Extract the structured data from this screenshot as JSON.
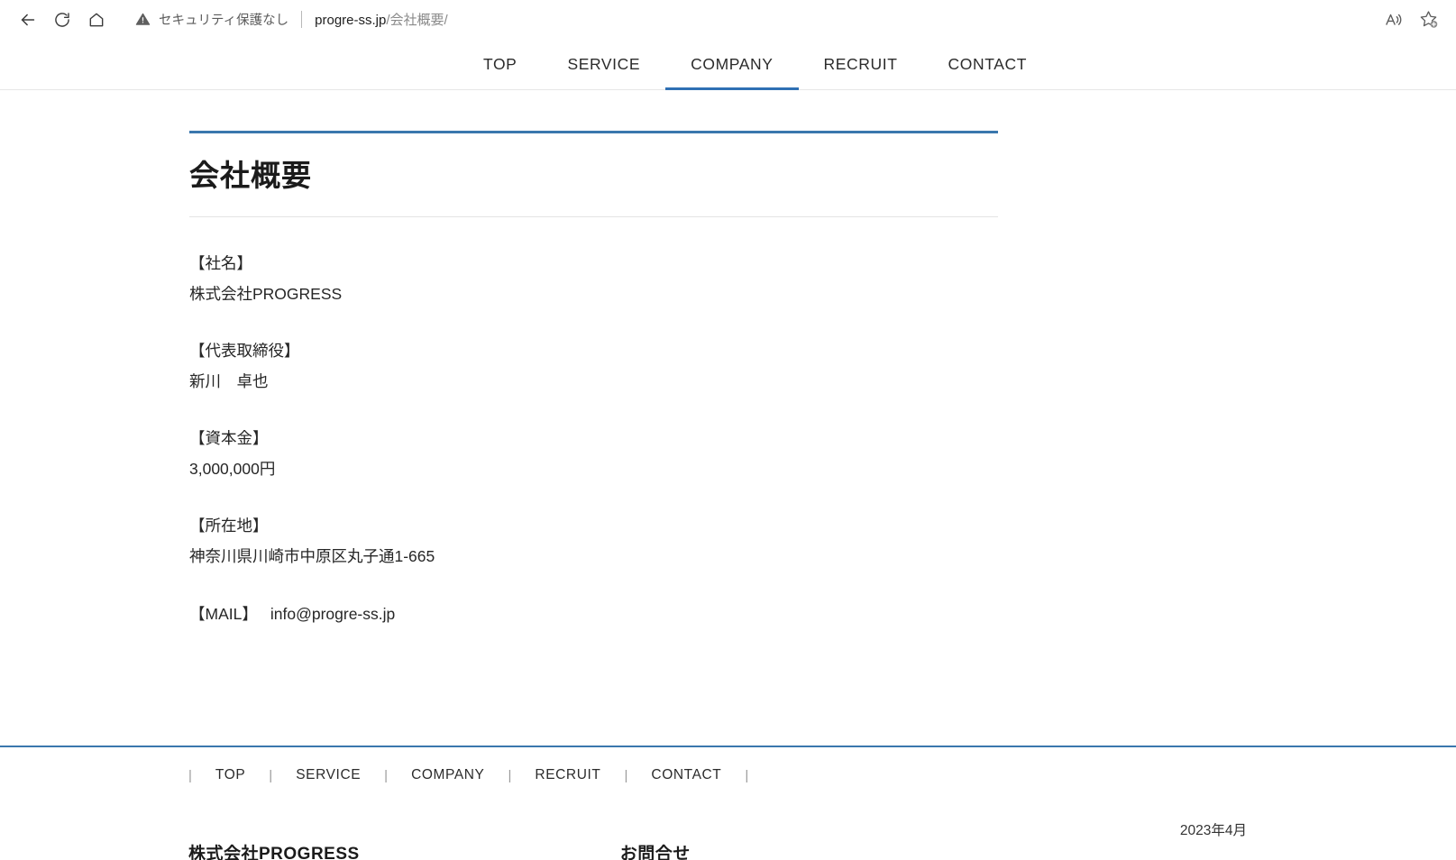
{
  "browser": {
    "back_icon": "back-arrow-icon",
    "reload_icon": "reload-icon",
    "home_icon": "home-icon",
    "security_warning_icon": "warning-triangle-icon",
    "security_text": "セキュリティ保護なし",
    "url_host": "progre-ss.jp",
    "url_path": "/会社概要/",
    "read_aloud_icon": "read-aloud-icon",
    "favorite_icon": "add-favorite-star-icon"
  },
  "header": {
    "nav": [
      {
        "label": "TOP",
        "active": false
      },
      {
        "label": "SERVICE",
        "active": false
      },
      {
        "label": "COMPANY",
        "active": true
      },
      {
        "label": "RECRUIT",
        "active": false
      },
      {
        "label": "CONTACT",
        "active": false
      }
    ]
  },
  "main": {
    "page_title": "会社概要",
    "info": [
      {
        "label": "【社名】",
        "value": "株式会社PROGRESS"
      },
      {
        "label": "【代表取締役】",
        "value": "新川　卓也"
      },
      {
        "label": "【資本金】",
        "value": "3,000,000円"
      },
      {
        "label": "【所在地】",
        "value": "神奈川県川崎市中原区丸子通1-665"
      }
    ],
    "mail_label": "【MAIL】",
    "mail_value": "info@progre-ss.jp"
  },
  "footer": {
    "nav": [
      "TOP",
      "SERVICE",
      "COMPANY",
      "RECRUIT",
      "CONTACT"
    ],
    "separator": "|",
    "company_name": "株式会社PROGRESS",
    "contact_heading": "お問合せ",
    "date": "2023年4月"
  },
  "colors": {
    "accent_blue": "#3a77ad",
    "nav_active_underline": "#2f70b4",
    "text_primary": "#262626",
    "text_muted": "#8a8a8a"
  }
}
